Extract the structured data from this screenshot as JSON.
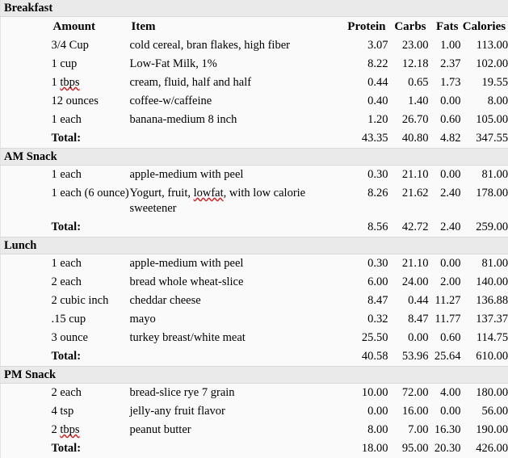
{
  "table": {
    "columns": {
      "amount": "Amount",
      "item": "Item",
      "protein": "Protein",
      "carbs": "Carbs",
      "fats": "Fats",
      "calories": "Calories"
    },
    "total_label": "Total:",
    "sections": [
      {
        "name": "Breakfast",
        "rows": [
          {
            "amount": "3/4 Cup",
            "item": "cold cereal, bran flakes, high fiber",
            "protein": "3.07",
            "carbs": "23.00",
            "fats": "1.00",
            "calories": "113.00"
          },
          {
            "amount": "1 cup",
            "item": "Low-Fat Milk, 1%",
            "protein": "8.22",
            "carbs": "12.18",
            "fats": "2.37",
            "calories": "102.00"
          },
          {
            "amount": "1 tbps",
            "amount_misspelled": "tbps",
            "amount_prefix": "1 ",
            "item": "cream, fluid, half and half",
            "protein": "0.44",
            "carbs": "0.65",
            "fats": "1.73",
            "calories": "19.55"
          },
          {
            "amount": "12 ounces",
            "item": "coffee-w/caffeine",
            "protein": "0.40",
            "carbs": "1.40",
            "fats": "0.00",
            "calories": "8.00"
          },
          {
            "amount": "1 each",
            "item": "banana-medium 8 inch",
            "protein": "1.20",
            "carbs": "26.70",
            "fats": "0.60",
            "calories": "105.00"
          }
        ],
        "total": {
          "protein": "43.35",
          "carbs": "40.80",
          "fats": "4.82",
          "calories": "347.55"
        }
      },
      {
        "name": "AM Snack",
        "rows": [
          {
            "amount": "1 each",
            "item": "apple-medium with peel",
            "protein": "0.30",
            "carbs": "21.10",
            "fats": "0.00",
            "calories": "81.00"
          },
          {
            "amount": "1 each (6 ounce)",
            "item": "Yogurt, fruit, lowfat, with low calorie sweetener",
            "item_misspelled": "lowfat",
            "item_prefix": "Yogurt, fruit, ",
            "item_suffix": ", with low calorie sweetener",
            "protein": "8.26",
            "carbs": "21.62",
            "fats": "2.40",
            "calories": "178.00"
          }
        ],
        "total": {
          "protein": "8.56",
          "carbs": "42.72",
          "fats": "2.40",
          "calories": "259.00"
        }
      },
      {
        "name": "Lunch",
        "rows": [
          {
            "amount": "1 each",
            "item": "apple-medium with peel",
            "protein": "0.30",
            "carbs": "21.10",
            "fats": "0.00",
            "calories": "81.00"
          },
          {
            "amount": "2 each",
            "item": "bread whole wheat-slice",
            "protein": "6.00",
            "carbs": "24.00",
            "fats": "2.00",
            "calories": "140.00"
          },
          {
            "amount": "2 cubic inch",
            "item": "cheddar cheese",
            "protein": "8.47",
            "carbs": "0.44",
            "fats": "11.27",
            "calories": "136.88"
          },
          {
            "amount": ".15 cup",
            "item": "mayo",
            "protein": "0.32",
            "carbs": "8.47",
            "fats": "11.77",
            "calories": "137.37"
          },
          {
            "amount": "3 ounce",
            "item": "turkey breast/white meat",
            "protein": "25.50",
            "carbs": "0.00",
            "fats": "0.60",
            "calories": "114.75"
          }
        ],
        "total": {
          "protein": "40.58",
          "carbs": "53.96",
          "fats": "25.64",
          "calories": "610.00"
        }
      },
      {
        "name": "PM Snack",
        "rows": [
          {
            "amount": "2 each",
            "item": "bread-slice rye 7 grain",
            "protein": "10.00",
            "carbs": "72.00",
            "fats": "4.00",
            "calories": "180.00"
          },
          {
            "amount": "4 tsp",
            "item": "jelly-any fruit flavor",
            "protein": "0.00",
            "carbs": "16.00",
            "fats": "0.00",
            "calories": "56.00"
          },
          {
            "amount": "2 tbps",
            "amount_misspelled": "tbps",
            "amount_prefix": "2 ",
            "item": "peanut butter",
            "protein": "8.00",
            "carbs": "7.00",
            "fats": "16.30",
            "calories": "190.00"
          }
        ],
        "total": {
          "protein": "18.00",
          "carbs": "95.00",
          "fats": "20.30",
          "calories": "426.00"
        }
      }
    ]
  },
  "colors": {
    "section_header_bg": "#eaeaea",
    "row_bg": "#fafafa",
    "border": "#d9d9d9",
    "spellcheck_underline": "#d42020",
    "text": "#000000"
  }
}
